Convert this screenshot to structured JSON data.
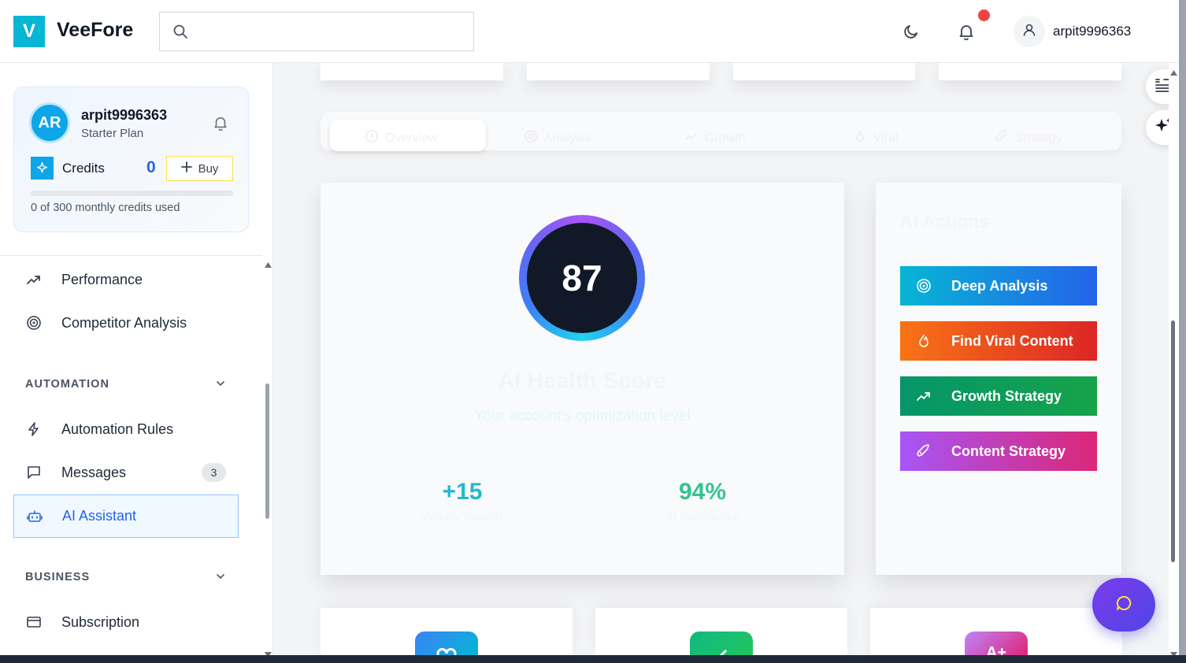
{
  "header": {
    "logo_letter": "V",
    "app_name": "VeeFore",
    "search_placeholder": "",
    "username": "arpit9996363"
  },
  "sidebar": {
    "plan_card": {
      "avatar_initials": "AR",
      "username": "arpit9996363",
      "plan": "Starter Plan",
      "credits_label": "Credits",
      "credits_value": "0",
      "buy_label": "Buy",
      "credits_used_text": "0 of 300 monthly credits used",
      "credits_progress": 0
    },
    "items": {
      "performance": "Performance",
      "competitor": "Competitor Analysis",
      "automation_rules": "Automation Rules",
      "messages": "Messages",
      "ai_assistant": "AI Assistant",
      "subscription": "Subscription"
    },
    "messages_badge": "3",
    "sections": {
      "automation": "AUTOMATION",
      "business": "BUSINESS"
    }
  },
  "main": {
    "tabs": {
      "overview": "Overview",
      "analysis": "Analysis",
      "growth": "Growth",
      "viral": "Viral",
      "strategy": "Strategy"
    },
    "health": {
      "score": "87",
      "title": "AI Health Score",
      "subtitle": "Your account's optimization level",
      "stat1_value": "+15",
      "stat1_label": "Weekly Growth",
      "stat2_value": "94%",
      "stat2_label": "AI Confidence"
    },
    "actions": {
      "title": "AI Actions",
      "deep_analysis": "Deep Analysis",
      "find_viral": "Find Viral Content",
      "growth_strategy": "Growth Strategy",
      "content_strategy": "Content Strategy"
    },
    "bottom_cards": {
      "card3_text": "A+"
    }
  },
  "colors": {
    "brand": "#06b6d4",
    "accent": "#2563eb",
    "deep_analysis": "#0ea5e9",
    "find_viral": "#f97316",
    "growth_strategy": "#16a34a",
    "content_strategy": "#a855f7"
  }
}
